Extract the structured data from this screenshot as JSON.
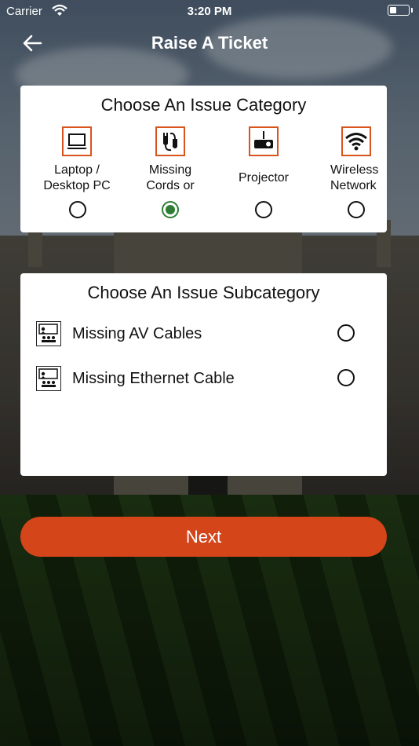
{
  "status_bar": {
    "carrier": "Carrier",
    "time": "3:20 PM"
  },
  "header": {
    "title": "Raise A Ticket",
    "back_icon": "arrow-left-icon"
  },
  "category_card": {
    "title": "Choose An Issue Category",
    "items": [
      {
        "label": "Laptop /\nDesktop PC",
        "icon": "laptop-icon",
        "selected": false
      },
      {
        "label": "Missing\nCords or",
        "icon": "cable-plug-icon",
        "selected": true
      },
      {
        "label": "Projector",
        "icon": "projector-icon",
        "selected": false
      },
      {
        "label": "Wireless\nNetwork",
        "icon": "wifi-icon",
        "selected": false
      }
    ]
  },
  "subcategory_card": {
    "title": "Choose An Issue Subcategory",
    "items": [
      {
        "label": "Missing AV Cables",
        "icon": "classroom-presentation-icon",
        "selected": false
      },
      {
        "label": "Missing Ethernet Cable",
        "icon": "classroom-presentation-icon",
        "selected": false
      }
    ]
  },
  "next_button": {
    "label": "Next"
  },
  "colors": {
    "accent": "#d4451a",
    "selected": "#2e7d32",
    "icon_border": "#d8541c"
  }
}
